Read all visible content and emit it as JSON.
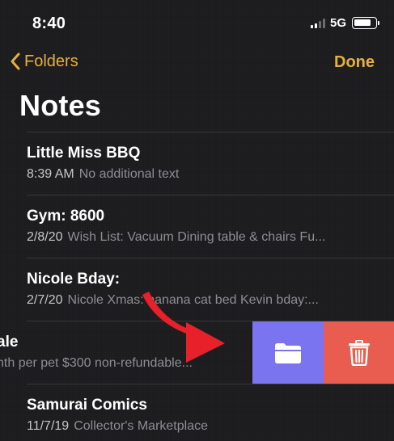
{
  "status_bar": {
    "time": "8:40",
    "network": "5G"
  },
  "nav": {
    "back_label": "Folders",
    "done_label": "Done"
  },
  "page": {
    "title": "Notes"
  },
  "notes": [
    {
      "title": "Little Miss BBQ",
      "date": "8:39 AM",
      "preview": "No additional text"
    },
    {
      "title": "Gym: 8600",
      "date": "2/8/20",
      "preview": "Wish List: Vacuum Dining table & chairs Fu..."
    },
    {
      "title": "Nicole Bday:",
      "date": "2/7/20",
      "preview": "Nicole Xmas: banana cat bed Kevin bday:..."
    },
    {
      "title": "ale",
      "date": "",
      "preview": "nth per pet $300 non-refundable..."
    },
    {
      "title": "Samurai Comics",
      "date": "11/7/19",
      "preview": "Collector's Marketplace"
    }
  ],
  "swipe_actions": {
    "folder_icon": "folder-icon",
    "delete_icon": "trash-icon"
  },
  "colors": {
    "accent": "#e5b13e",
    "folder_action": "#7b74f0",
    "delete_action": "#e85d4f",
    "arrow": "#e8202a"
  }
}
